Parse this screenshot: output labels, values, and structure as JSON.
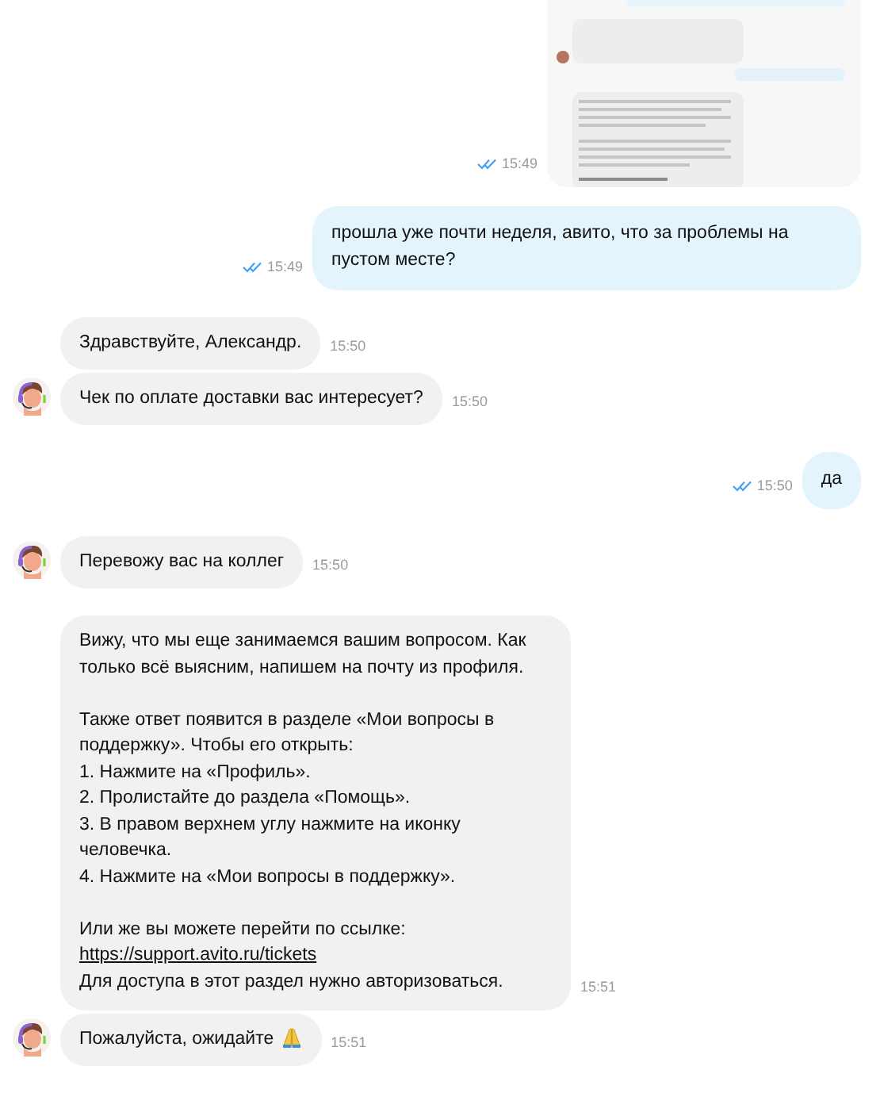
{
  "groups": [
    {
      "kind": "outgoing",
      "messages": [
        {
          "kind": "picture",
          "time": "15:49",
          "read": true
        },
        {
          "kind": "text",
          "parts": [
            {
              "kind": "text",
              "text": "прошла уже почти неделя, авито, что за проблемы на пустом месте?"
            }
          ],
          "time": "15:49",
          "read": true
        }
      ]
    },
    {
      "kind": "incoming",
      "messages": [
        {
          "kind": "text",
          "parts": [
            {
              "kind": "text",
              "text": "Здравствуйте, Александр."
            }
          ],
          "time": "15:50"
        },
        {
          "kind": "text",
          "parts": [
            {
              "kind": "text",
              "text": "Чек по оплате доставки вас интересует?"
            }
          ],
          "time": "15:50"
        }
      ]
    },
    {
      "kind": "outgoing",
      "messages": [
        {
          "kind": "text",
          "parts": [
            {
              "kind": "text",
              "text": "да"
            }
          ],
          "time": "15:50",
          "read": true
        }
      ]
    },
    {
      "kind": "incoming",
      "messages": [
        {
          "kind": "text",
          "parts": [
            {
              "kind": "text",
              "text": "Перевожу вас на коллег"
            }
          ],
          "time": "15:50"
        }
      ]
    },
    {
      "kind": "incoming",
      "messages": [
        {
          "kind": "text",
          "parts": [
            {
              "kind": "text",
              "text": "Вижу, что мы еще занимаемся вашим вопросом. Как только всё выясним, напишем на почту из профиля.\n\nТакже ответ появится в разделе «Мои вопросы в поддержку». Чтобы его открыть:\n1. Нажмите на «Профиль».\n2. Пролистайте до раздела «Помощь».\n3. В правом верхнем углу нажмите на иконку человечка.\n4. Нажмите на «Мои вопросы в поддержку».\n\nИли же вы можете перейти по ссылке:"
            },
            {
              "kind": "link",
              "text": "https://support.avito.ru/tickets"
            },
            {
              "kind": "text",
              "text": "Для доступа в этот раздел нужно авторизоваться."
            }
          ],
          "time": "15:51"
        },
        {
          "kind": "text",
          "parts": [
            {
              "kind": "text",
              "text": "Пожалуйста, ожидайте"
            },
            {
              "kind": "emoji"
            }
          ],
          "time": "15:51"
        }
      ]
    }
  ]
}
